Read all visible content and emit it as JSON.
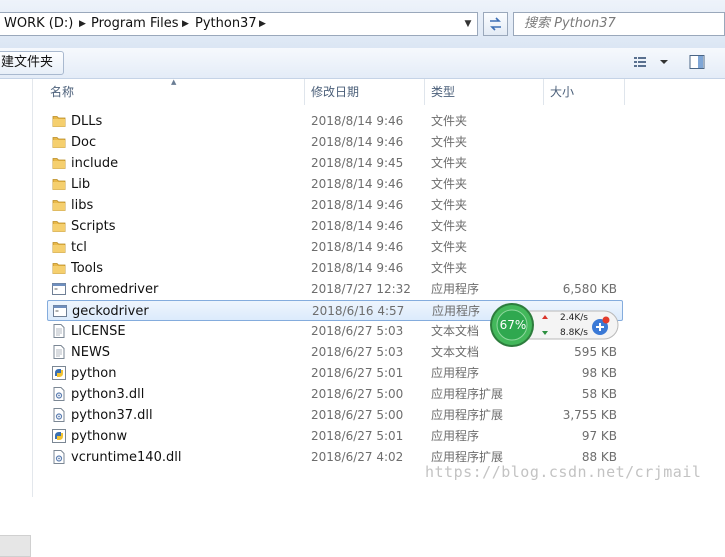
{
  "address": {
    "crumbs": [
      "WORK (D:)",
      "Program Files",
      "Python37"
    ],
    "search_placeholder": "搜索 Python37"
  },
  "toolbar": {
    "new_folder_label": "建文件夹"
  },
  "columns": {
    "name": "名称",
    "date": "修改日期",
    "type": "类型",
    "size": "大小"
  },
  "files": [
    {
      "name": "DLLs",
      "date": "2018/8/14 9:46",
      "type": "文件夹",
      "size": "",
      "icon": "folder-icon"
    },
    {
      "name": "Doc",
      "date": "2018/8/14 9:46",
      "type": "文件夹",
      "size": "",
      "icon": "folder-icon"
    },
    {
      "name": "include",
      "date": "2018/8/14 9:45",
      "type": "文件夹",
      "size": "",
      "icon": "folder-icon"
    },
    {
      "name": "Lib",
      "date": "2018/8/14 9:46",
      "type": "文件夹",
      "size": "",
      "icon": "folder-icon"
    },
    {
      "name": "libs",
      "date": "2018/8/14 9:46",
      "type": "文件夹",
      "size": "",
      "icon": "folder-icon"
    },
    {
      "name": "Scripts",
      "date": "2018/8/14 9:46",
      "type": "文件夹",
      "size": "",
      "icon": "folder-icon"
    },
    {
      "name": "tcl",
      "date": "2018/8/14 9:46",
      "type": "文件夹",
      "size": "",
      "icon": "folder-icon"
    },
    {
      "name": "Tools",
      "date": "2018/8/14 9:46",
      "type": "文件夹",
      "size": "",
      "icon": "folder-icon"
    },
    {
      "name": "chromedriver",
      "date": "2018/7/27 12:32",
      "type": "应用程序",
      "size": "6,580 KB",
      "icon": "exe-icon"
    },
    {
      "name": "geckodriver",
      "date": "2018/6/16 4:57",
      "type": "应用程序",
      "size": "",
      "icon": "exe-icon",
      "selected": true
    },
    {
      "name": "LICENSE",
      "date": "2018/6/27 5:03",
      "type": "文本文档",
      "size": "",
      "icon": "text-file-icon"
    },
    {
      "name": "NEWS",
      "date": "2018/6/27 5:03",
      "type": "文本文档",
      "size": "595 KB",
      "icon": "text-file-icon"
    },
    {
      "name": "python",
      "date": "2018/6/27 5:01",
      "type": "应用程序",
      "size": "98 KB",
      "icon": "python-icon"
    },
    {
      "name": "python3.dll",
      "date": "2018/6/27 5:00",
      "type": "应用程序扩展",
      "size": "58 KB",
      "icon": "dll-icon"
    },
    {
      "name": "python37.dll",
      "date": "2018/6/27 5:00",
      "type": "应用程序扩展",
      "size": "3,755 KB",
      "icon": "dll-icon"
    },
    {
      "name": "pythonw",
      "date": "2018/6/27 5:01",
      "type": "应用程序",
      "size": "97 KB",
      "icon": "python-icon"
    },
    {
      "name": "vcruntime140.dll",
      "date": "2018/6/27 4:02",
      "type": "应用程序扩展",
      "size": "88 KB",
      "icon": "dll-icon"
    }
  ],
  "net_widget": {
    "percent": "67%",
    "up": "2.4K/s",
    "down": "8.8K/s"
  },
  "watermark": "https://blog.csdn.net/crjmail",
  "colors": {
    "selection": "#dcebfc",
    "folder": "#e8b84a",
    "widget_green": "#2fa84f"
  }
}
